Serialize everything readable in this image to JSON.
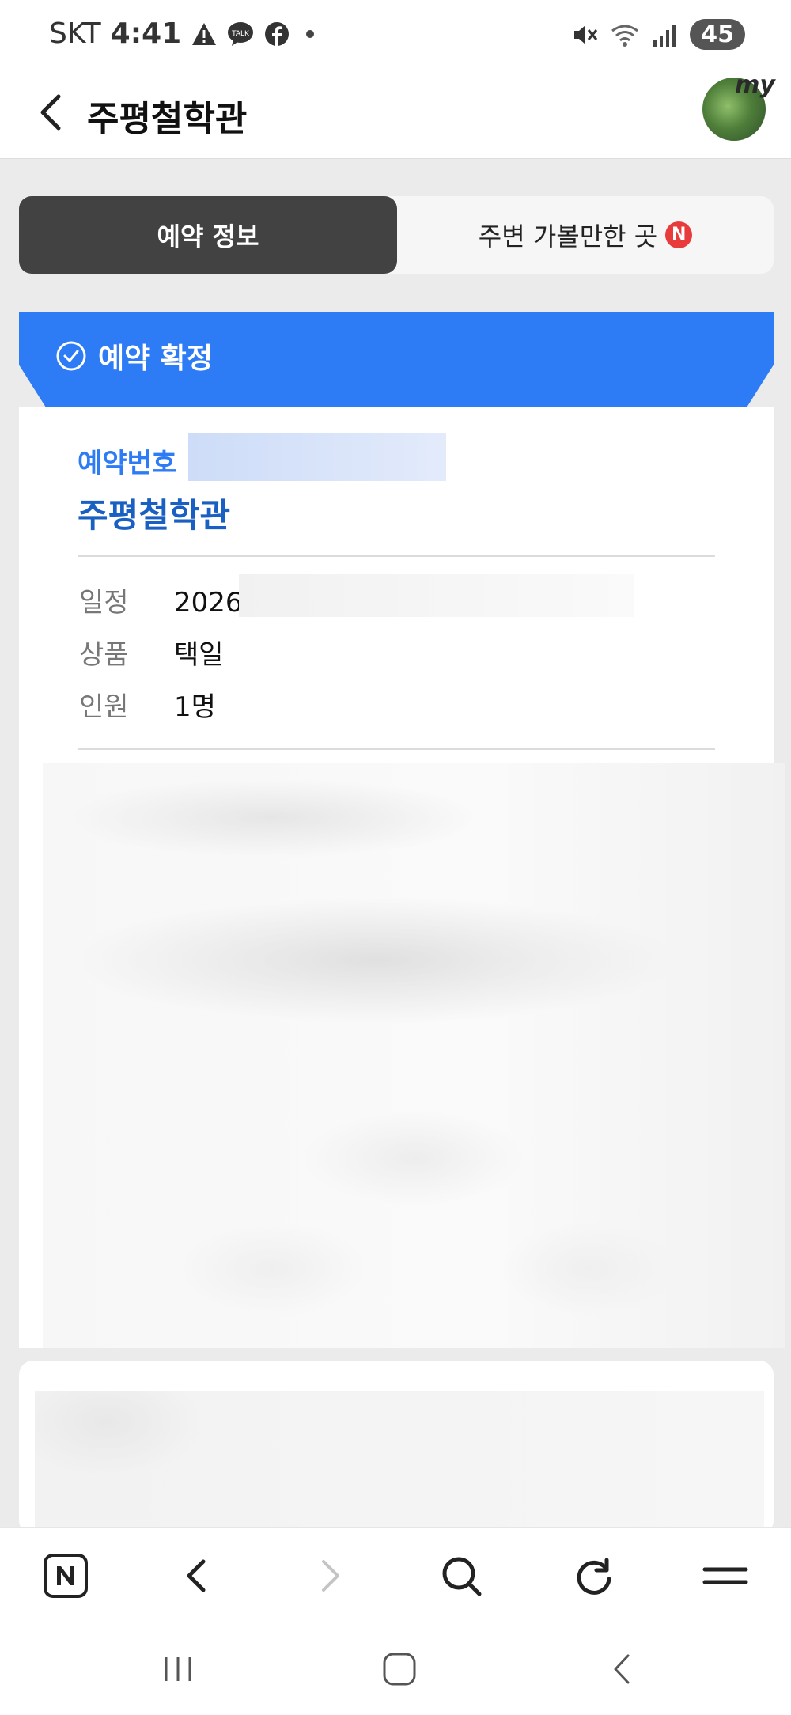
{
  "status_bar": {
    "carrier": "SKT",
    "time": "4:41",
    "battery": "45",
    "kakaotalk_badge": "TALK"
  },
  "header": {
    "title": "주평철학관",
    "avatar_text": "my"
  },
  "tabs": [
    {
      "label": "예약 정보",
      "active": true
    },
    {
      "label": "주변 가볼만한 곳",
      "active": false,
      "badge": "N"
    }
  ],
  "banner": {
    "text": "예약 확정",
    "color": "#2e7bf6"
  },
  "reservation": {
    "number_label": "예약번호",
    "venue_name": "주평철학관",
    "rows": [
      {
        "label": "일정",
        "value": "2026"
      },
      {
        "label": "상품",
        "value": "택일"
      },
      {
        "label": "인원",
        "value": "1명"
      }
    ]
  },
  "toolbar": {
    "items": [
      "naver-home-icon",
      "back-arrow-icon",
      "forward-arrow-icon",
      "search-icon",
      "refresh-icon",
      "menu-icon"
    ]
  },
  "system_nav": {
    "items": [
      "recent-apps-icon",
      "home-icon",
      "back-icon"
    ]
  }
}
